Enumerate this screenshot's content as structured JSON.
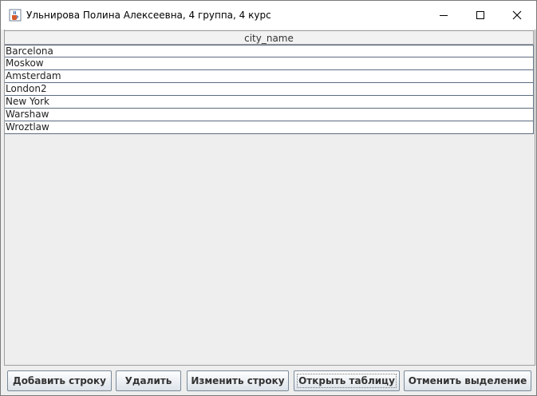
{
  "window": {
    "title": "Ульнирова Полина Алексеевна, 4 группа, 4 курс"
  },
  "table": {
    "columns": [
      "city_name"
    ],
    "rows": [
      "Barcelona",
      "Moskow",
      "Amsterdam",
      "London2",
      "New York",
      "Warshaw",
      "Wroztlaw"
    ]
  },
  "buttons": {
    "add": "Добавить строку",
    "delete": "Удалить",
    "edit": "Изменить строку",
    "open": "Открыть таблицу",
    "cancel_selection": "Отменить выделение"
  },
  "icons": {
    "app": "java-cup-icon",
    "minimize": "minimize-icon",
    "maximize": "maximize-icon",
    "close": "close-icon"
  }
}
